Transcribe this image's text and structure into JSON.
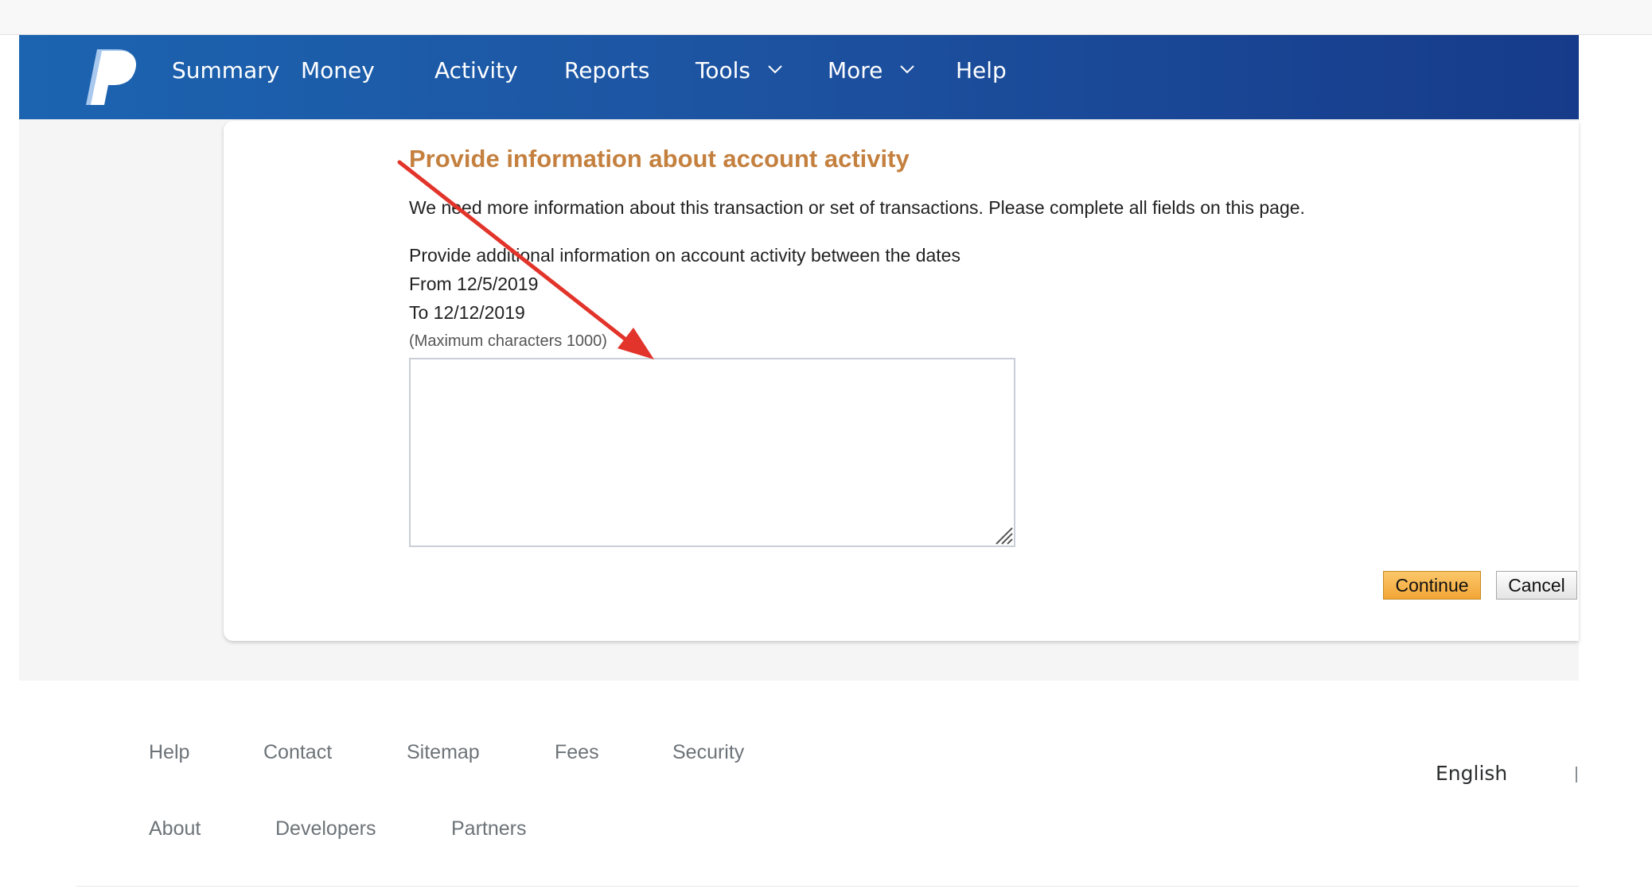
{
  "nav": {
    "logo_icon": "paypal-logo-icon",
    "items": [
      {
        "label": "Summary"
      },
      {
        "label": "Money"
      },
      {
        "label": "Activity"
      },
      {
        "label": "Reports"
      },
      {
        "label": "Tools",
        "icon": "chevron-down-icon"
      },
      {
        "label": "More",
        "icon": "chevron-down-icon"
      },
      {
        "label": "Help"
      }
    ]
  },
  "form": {
    "title": "Provide information about account activity",
    "intro": "We need more information about this transaction or set of transactions. Please complete all fields on this page.",
    "prompt": "Provide additional information on account activity between the dates",
    "from": "From 12/5/2019",
    "to": "To 12/12/2019",
    "max_chars_note": "(Maximum characters 1000)",
    "textarea_value": "",
    "continue_label": "Continue",
    "cancel_label": "Cancel"
  },
  "annotation": {
    "icon": "red-arrow-annotation",
    "color": "#e2342a"
  },
  "footer": {
    "row1": [
      "Help",
      "Contact",
      "Sitemap",
      "Fees",
      "Security"
    ],
    "row2": [
      "About",
      "Developers",
      "Partners"
    ],
    "language": "English"
  },
  "colors": {
    "nav_bg_start": "#1c64b0",
    "nav_bg_end": "#163b8a",
    "title": "#c4803f",
    "continue_button": "#f3a637"
  }
}
